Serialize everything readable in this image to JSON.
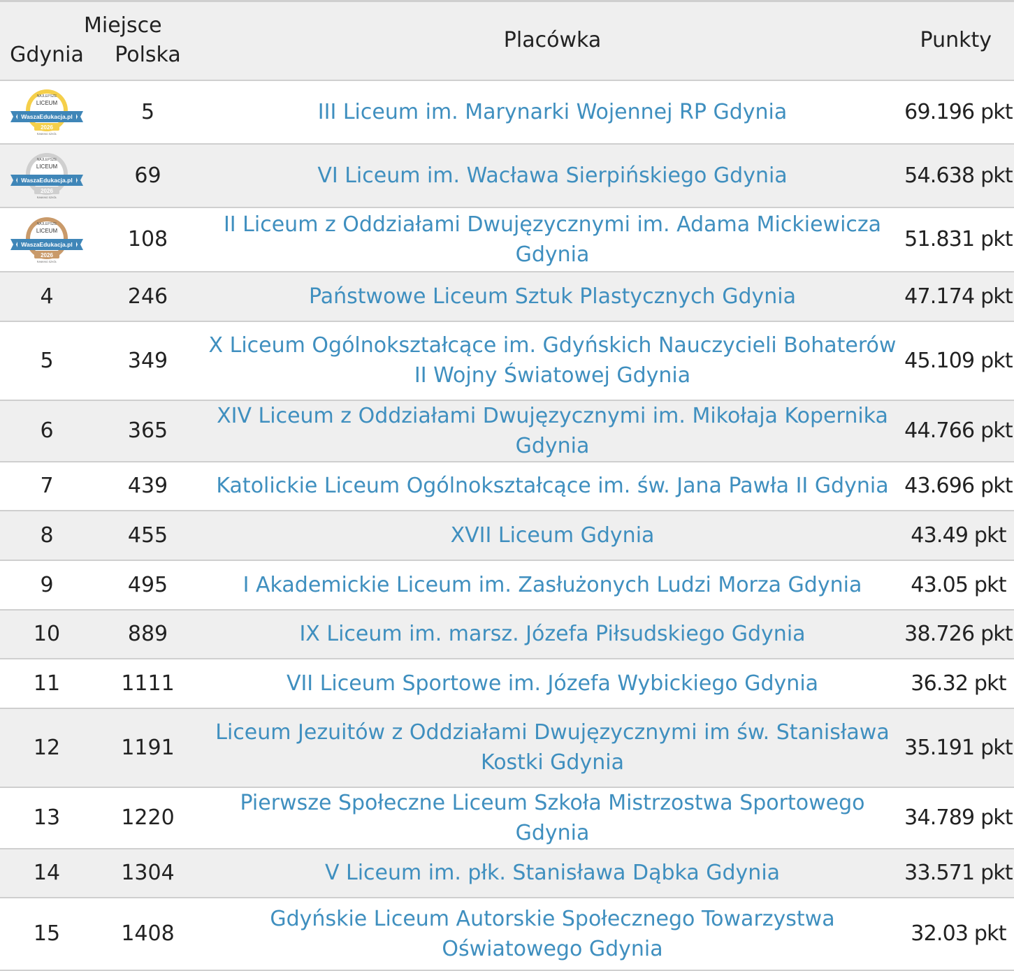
{
  "header": {
    "miejsce": "Miejsce",
    "gdynia": "Gdynia",
    "polska": "Polska",
    "placowka": "Placówka",
    "punkty": "Punkty"
  },
  "badge": {
    "top": "NAJLEPSZE",
    "liceum": "LICEUM",
    "site": "WaszaEdukacja.pl",
    "year": "2026",
    "bottom": "RANKING SZKÓŁ",
    "colors": {
      "gold": "#f5cf4a",
      "silver": "#cfcfcf",
      "bronze": "#c99a6a",
      "ribbon": "#3f86b8"
    }
  },
  "rows": [
    {
      "gdynia": "",
      "badge": "gold",
      "polska": "5",
      "name": "III Liceum im. Marynarki Wojennej RP Gdynia",
      "points": "69.196 pkt"
    },
    {
      "gdynia": "",
      "badge": "silver",
      "polska": "69",
      "name": "VI Liceum im. Wacława Sierpińskiego Gdynia",
      "points": "54.638 pkt"
    },
    {
      "gdynia": "",
      "badge": "bronze",
      "polska": "108",
      "name": "II Liceum z Oddziałami Dwujęzycznymi im. Adama Mickiewicza Gdynia",
      "points": "51.831 pkt"
    },
    {
      "gdynia": "4",
      "polska": "246",
      "name": "Państwowe Liceum Sztuk Plastycznych Gdynia",
      "points": "47.174 pkt"
    },
    {
      "gdynia": "5",
      "polska": "349",
      "name": "X Liceum Ogólnokształcące im. Gdyńskich Nauczycieli Bohaterów II Wojny Światowej Gdynia",
      "points": "45.109 pkt"
    },
    {
      "gdynia": "6",
      "polska": "365",
      "name": "XIV Liceum z Oddziałami Dwujęzycznymi im. Mikołaja Kopernika Gdynia",
      "points": "44.766 pkt"
    },
    {
      "gdynia": "7",
      "polska": "439",
      "name": "Katolickie Liceum Ogólnokształcące im. św. Jana Pawła II Gdynia",
      "points": "43.696 pkt"
    },
    {
      "gdynia": "8",
      "polska": "455",
      "name": "XVII Liceum Gdynia",
      "points": "43.49 pkt"
    },
    {
      "gdynia": "9",
      "polska": "495",
      "name": "I Akademickie Liceum im. Zasłużonych Ludzi Morza Gdynia",
      "points": "43.05 pkt"
    },
    {
      "gdynia": "10",
      "polska": "889",
      "name": "IX Liceum im. marsz. Józefa Piłsudskiego Gdynia",
      "points": "38.726 pkt"
    },
    {
      "gdynia": "11",
      "polska": "1111",
      "name": "VII Liceum Sportowe im. Józefa Wybickiego Gdynia",
      "points": "36.32 pkt"
    },
    {
      "gdynia": "12",
      "polska": "1191",
      "name": "Liceum Jezuitów z Oddziałami Dwujęzycznymi im św. Stanisława Kostki Gdynia",
      "points": "35.191 pkt"
    },
    {
      "gdynia": "13",
      "polska": "1220",
      "name": "Pierwsze Społeczne Liceum Szkoła Mistrzostwa Sportowego Gdynia",
      "points": "34.789 pkt"
    },
    {
      "gdynia": "14",
      "polska": "1304",
      "name": "V Liceum im. płk. Stanisława Dąbka Gdynia",
      "points": "33.571 pkt"
    },
    {
      "gdynia": "15",
      "polska": "1408",
      "name": "Gdyńskie Liceum Autorskie Społecznego Towarzystwa Oświatowego Gdynia",
      "points": "32.03 pkt"
    }
  ]
}
